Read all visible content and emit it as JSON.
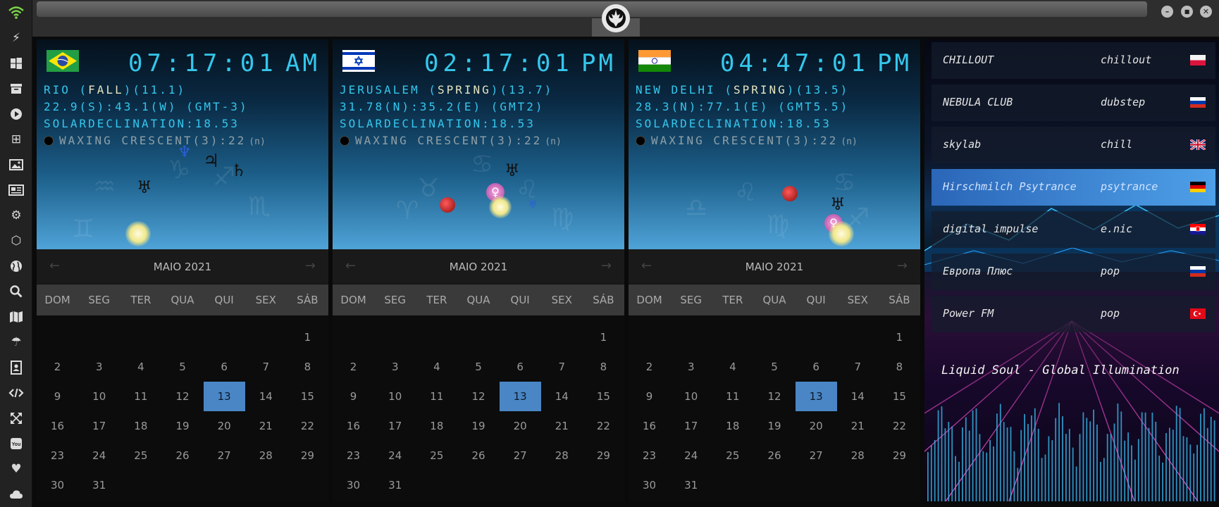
{
  "app": {
    "title_icon": "rebel-alliance-logo-icon"
  },
  "sidebar": {
    "icons": [
      "wifi-icon",
      "lightning-icon",
      "windows-icon",
      "archive-icon",
      "play-icon",
      "map-fold-icon",
      "image-icon",
      "news-icon",
      "cog-icon",
      "hexagon-icon",
      "globe-icon",
      "search-icon",
      "map-icon",
      "umbrella-icon",
      "contacts-icon",
      "code-icon",
      "expand-icon",
      "youtube-icon",
      "heart-icon",
      "cloud-icon"
    ]
  },
  "window_controls": {
    "minimize": "–",
    "maximize": "■",
    "close": "✕"
  },
  "panels": [
    {
      "flag": "brazil",
      "time": "07:17:01",
      "ampm": "AM",
      "city": "RIO",
      "season": "FALL",
      "season_index": "11.1",
      "coords": "22.9(S):43.1(W)",
      "gmt": "GMT-3",
      "solar": "SOLARDECLINATION:18.53",
      "moon": "WAXING CRESCENT(3):22",
      "moon_sup": "(n)",
      "calendar": {
        "month": "MAIO 2021",
        "selected": 13
      }
    },
    {
      "flag": "israel",
      "time": "02:17:01",
      "ampm": "PM",
      "city": "JERUSALEM",
      "season": "SPRING",
      "season_index": "13.7",
      "coords": "31.78(N):35.2(E)",
      "gmt": "GMT2",
      "solar": "SOLARDECLINATION:18.53",
      "moon": "WAXING CRESCENT(3):22",
      "moon_sup": "(n)",
      "calendar": {
        "month": "MAIO 2021",
        "selected": 13
      }
    },
    {
      "flag": "india",
      "time": "04:47:01",
      "ampm": "PM",
      "city": "NEW DELHI",
      "season": "SPRING",
      "season_index": "13.5",
      "coords": "28.3(N):77.1(E)",
      "gmt": "GMT5.5",
      "solar": "SOLARDECLINATION:18.53",
      "moon": "WAXING CRESCENT(3):22",
      "moon_sup": "(n)",
      "calendar": {
        "month": "MAIO 2021",
        "selected": 13
      }
    }
  ],
  "calendar_common": {
    "weekdays": [
      "DOM",
      "SEG",
      "TER",
      "QUA",
      "QUI",
      "SEX",
      "SÁB"
    ],
    "weeks": [
      [
        "",
        "",
        "",
        "",
        "",
        "",
        "1"
      ],
      [
        "2",
        "3",
        "4",
        "5",
        "6",
        "7",
        "8"
      ],
      [
        "9",
        "10",
        "11",
        "12",
        "13",
        "14",
        "15"
      ],
      [
        "16",
        "17",
        "18",
        "19",
        "20",
        "21",
        "22"
      ],
      [
        "23",
        "24",
        "25",
        "26",
        "27",
        "28",
        "29"
      ],
      [
        "30",
        "31",
        "",
        "",
        "",
        "",
        ""
      ]
    ],
    "prev": "←",
    "next": "→"
  },
  "radio": {
    "stations": [
      {
        "name": "CHILLOUT",
        "genre": "chillout",
        "flag": "poland"
      },
      {
        "name": "NEBULA CLUB",
        "genre": "dubstep",
        "flag": "russia"
      },
      {
        "name": "skylab",
        "genre": "chill",
        "flag": "uk"
      },
      {
        "name": "Hirschmilch Psytrance",
        "genre": "psytrance",
        "flag": "germany"
      },
      {
        "name": "digital impulse",
        "genre": "e.nic",
        "flag": "croatia"
      },
      {
        "name": "Европа Плюс",
        "genre": "pop",
        "flag": "russia"
      },
      {
        "name": "Power FM",
        "genre": "pop",
        "flag": "turkey"
      }
    ],
    "active_index": 3,
    "now_playing": "Liquid Soul - Global Illumination"
  },
  "colors": {
    "accent": "#35c7ec",
    "selected_day": "#4a86c5",
    "active_station": "#3a82d4"
  }
}
